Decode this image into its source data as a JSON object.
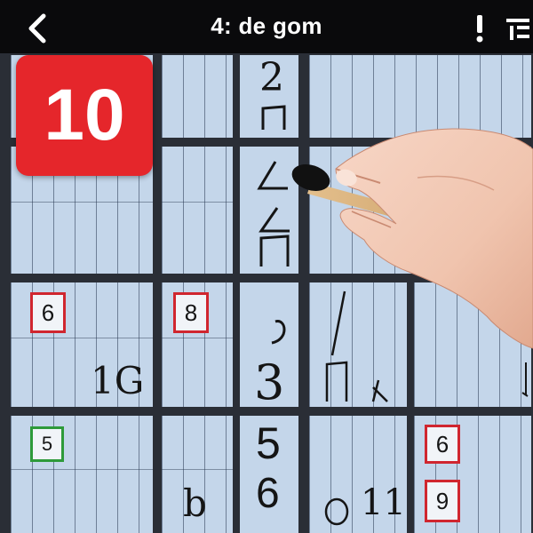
{
  "header": {
    "title": "4: de gom",
    "back_icon": "chevron-left-icon",
    "alert_icon": "exclamation-icon",
    "menu_icon": "menu-icon"
  },
  "badge": {
    "value": "10",
    "color": "#e5262b"
  },
  "board": {
    "cells": {
      "r1c3_top": "2",
      "r4c1_boxed": "6",
      "r4c2_boxed": "8",
      "r5c1": "1G",
      "r5c3": "3",
      "r6c1_boxed": "5",
      "r6c3_top": "5",
      "r6c5_boxed": "6",
      "r7c3": "6",
      "r7c2": "b",
      "r7c4": "11",
      "r7c5_boxed": "9"
    },
    "colors": {
      "cell": "#c4d6ea",
      "grid_line": "#2a2e36",
      "highlight_red": "#d0262f",
      "highlight_green": "#2e9a3a"
    }
  }
}
